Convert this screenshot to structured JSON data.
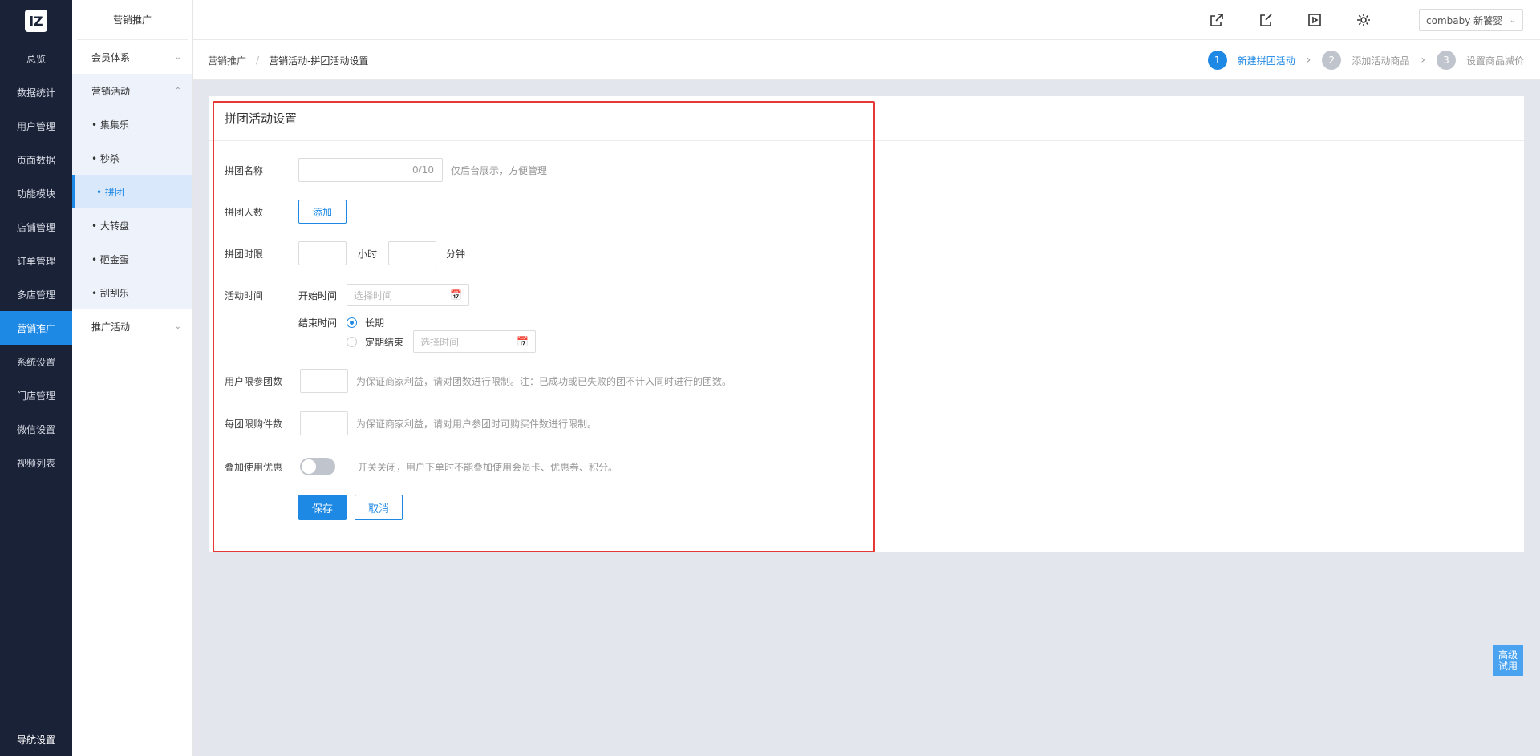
{
  "leftnav": {
    "logo_text": "iZ",
    "items": [
      "总览",
      "数据统计",
      "用户管理",
      "页面数据",
      "功能模块",
      "店铺管理",
      "订单管理",
      "多店管理",
      "营销推广",
      "系统设置",
      "门店管理",
      "微信设置",
      "视频列表"
    ],
    "active_index": 8,
    "bottom": "导航设置"
  },
  "submenu": {
    "title": "营销推广",
    "member": "会员体系",
    "activity": "营销活动",
    "children": [
      "• 集集乐",
      "• 秒杀",
      "• 拼团",
      "• 大转盘",
      "• 砸金蛋",
      "• 刮刮乐"
    ],
    "active_child": 2,
    "promo": "推广活动"
  },
  "topbar": {
    "icons": [
      "external-link-icon",
      "edit-icon",
      "play-icon",
      "gear-icon"
    ],
    "user": "combaby 新饕婴"
  },
  "breadcrumb": {
    "root": "营销推广",
    "sep": "/",
    "current": "营销活动-拼团活动设置"
  },
  "steps": [
    {
      "num": "1",
      "label": "新建拼团活动"
    },
    {
      "num": "2",
      "label": "添加活动商品"
    },
    {
      "num": "3",
      "label": "设置商品减价"
    }
  ],
  "form": {
    "title": "拼团活动设置",
    "name_label": "拼团名称",
    "name_counter": "0/10",
    "name_hint": "仅后台展示，方便管理",
    "count_label": "拼团人数",
    "count_btn": "添加",
    "limit_label": "拼团时限",
    "hours_unit": "小时",
    "minutes_unit": "分钟",
    "time_label": "活动时间",
    "start_label": "开始时间",
    "date_placeholder": "选择时间",
    "end_label": "结束时间",
    "end_long": "长期",
    "end_fixed": "定期结束",
    "user_limit_label": "用户限参团数",
    "user_limit_hint": "为保证商家利益，请对团数进行限制。注：已成功或已失败的团不计入同时进行的团数。",
    "buy_limit_label": "每团限购件数",
    "buy_limit_hint": "为保证商家利益，请对用户参团时可购买件数进行限制。",
    "stack_label": "叠加使用优惠",
    "stack_hint": "开关关闭，用户下单时不能叠加使用会员卡、优惠券、积分。",
    "save": "保存",
    "cancel": "取消"
  },
  "float_trial": {
    "line1": "高级",
    "line2": "试用"
  },
  "colors": {
    "accent": "#1e88e5",
    "nav_bg": "#1a2238",
    "highlight": "#e53935"
  }
}
